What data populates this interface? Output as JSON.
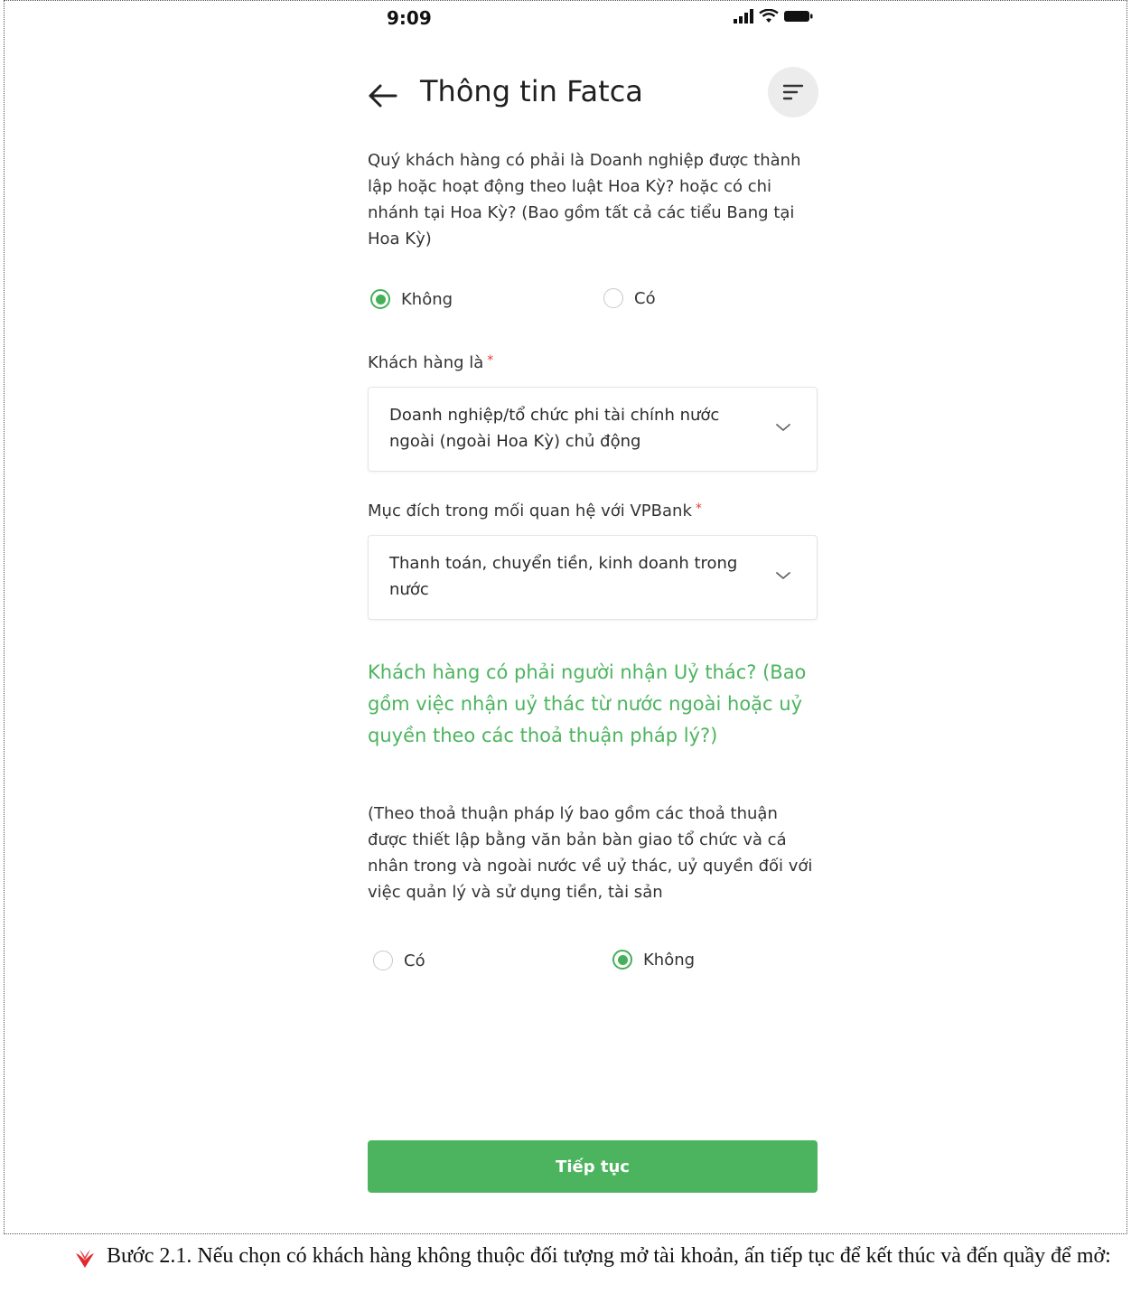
{
  "status_bar": {
    "time": "9:09"
  },
  "header": {
    "title": "Thông tin Fatca"
  },
  "question_1": {
    "text": "Quý khách hàng có phải là Doanh nghiệp được thành lập hoặc hoạt động theo luật Hoa Kỳ? hoặc có chi nhánh tại Hoa Kỳ? (Bao gồm tất cả các tiểu Bang tại Hoa Kỳ)",
    "options": [
      {
        "label": "Không",
        "selected": true
      },
      {
        "label": "Có",
        "selected": false
      }
    ]
  },
  "customer_type": {
    "label": "Khách hàng là",
    "required_mark": "*",
    "value": "Doanh nghiệp/tổ chức phi tài chính nước ngoài (ngoài Hoa Kỳ) chủ động"
  },
  "purpose": {
    "label": "Mục đích trong mối quan hệ với VPBank",
    "required_mark": "*",
    "value": "Thanh toán, chuyển tiền, kinh doanh trong nước"
  },
  "question_2": {
    "title": "Khách hàng có phải người nhận Uỷ thác? (Bao gồm việc nhận uỷ thác từ nước ngoài hoặc uỷ quyền theo các thoả thuận pháp lý?)",
    "explanation": "(Theo thoả thuận pháp lý bao gồm các thoả thuận được thiết lập bằng văn bản bàn giao tổ chức và cá nhân trong và ngoài nước về uỷ thác, uỷ quyền đối với việc quản lý và sử dụng tiền, tài sản",
    "options": [
      {
        "label": "Có",
        "selected": false
      },
      {
        "label": "Không",
        "selected": true
      }
    ]
  },
  "continue_button": {
    "label": "Tiếp tục"
  },
  "note": {
    "text": "Bước 2.1. Nếu chọn có khách hàng không thuộc đối tượng mở tài khoản, ấn tiếp tục để kết thúc và đến quầy để mở:",
    "accent_color": "#e0282e"
  },
  "colors": {
    "primary_green": "#4cb45e",
    "required_red": "#e43a3a"
  }
}
